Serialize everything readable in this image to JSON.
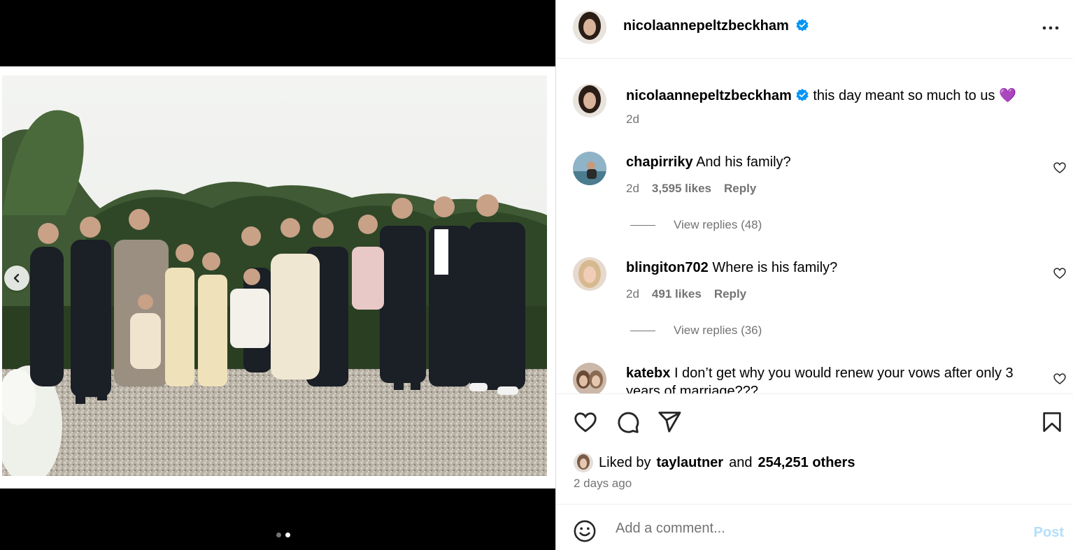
{
  "post": {
    "author": "nicolaannepeltzbeckham",
    "caption": "this day meant so much to us 💜",
    "caption_age": "2d"
  },
  "comments": [
    {
      "username": "chapirriky",
      "text": "And his family?",
      "age": "2d",
      "likes": "3,595 likes",
      "reply": "Reply",
      "view_replies": "View replies (48)"
    },
    {
      "username": "blingiton702",
      "text": "Where is his family?",
      "age": "2d",
      "likes": "491 likes",
      "reply": "Reply",
      "view_replies": "View replies (36)"
    },
    {
      "username": "katebx",
      "text": "I don’t get why you would renew your vows after only 3",
      "text2": "years of marriage???"
    }
  ],
  "likes": {
    "prefix": "Liked by",
    "user": "taylautner",
    "and": "and",
    "others": "254,251 others"
  },
  "posted_ago": "2 days ago",
  "composer": {
    "placeholder": "Add a comment...",
    "post_label": "Post"
  },
  "carousel": {
    "slides": 2,
    "active_slide": 2
  },
  "colors": {
    "verified": "#0095f6",
    "secondary_text": "#737373",
    "post_disabled": "#b2dffc"
  },
  "icons": [
    "verified-badge-icon",
    "more-options-icon",
    "chevron-left-icon",
    "heart-icon",
    "comment-icon",
    "share-icon",
    "bookmark-icon",
    "emoji-icon"
  ]
}
